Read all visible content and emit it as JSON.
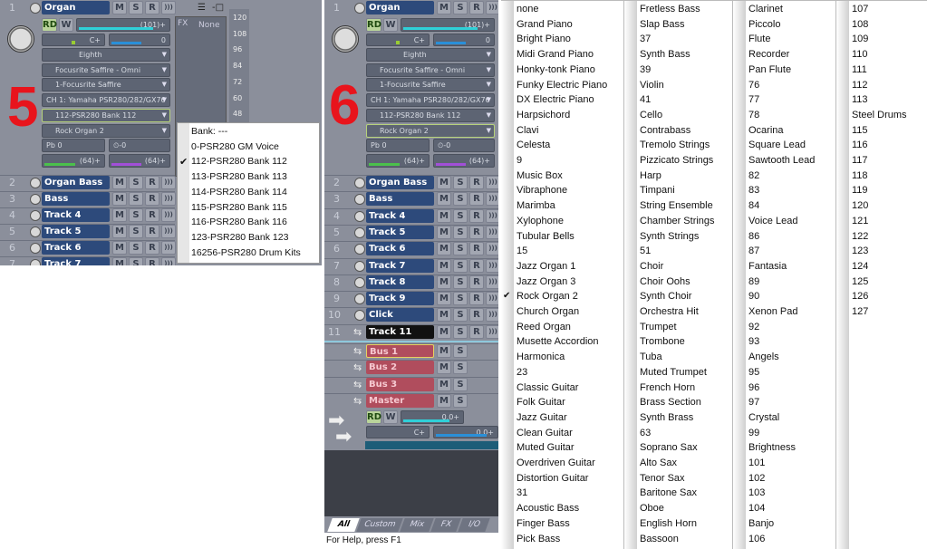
{
  "annotations": {
    "left": "5",
    "middle": "6"
  },
  "colors": {
    "track_name": "#2d4a7b",
    "bus_name": "#b04d5d",
    "panel": "#8b8f9b",
    "annotation_red": "#e8141c",
    "volume_fill": "#2fd0d8",
    "pan_fill": "#2a8fd8",
    "chorus_fill": "#4bc04b",
    "reverb_fill": "#a24fd8"
  },
  "track1": {
    "number": "1",
    "name": "Organ",
    "buttons": [
      "M",
      "S",
      "R",
      ")))"
    ],
    "read": "RD",
    "write": "W",
    "volume": "(101)+",
    "volume_pct": 80,
    "pan": "C+",
    "meter_value": "0",
    "quantize": "Eighth",
    "input": "Focusrite Saffire - Omni",
    "output": "1-Focusrite Saffire",
    "channel": "CH 1: Yamaha PSR280/282/GX76",
    "bank": "112-PSR280 Bank 112",
    "program": "Rock Organ 2",
    "pitch_bend": "0",
    "key_offset": "0",
    "chorus": "(64)+",
    "reverb": "(64)+",
    "fx_label": "FX",
    "fx_value": "None",
    "scale": [
      "120",
      "108",
      "96",
      "84",
      "72",
      "60",
      "48"
    ]
  },
  "left_tracks": [
    {
      "number": "2",
      "name": "Organ Bass"
    },
    {
      "number": "3",
      "name": "Bass"
    },
    {
      "number": "4",
      "name": "Track 4"
    },
    {
      "number": "5",
      "name": "Track 5"
    },
    {
      "number": "6",
      "name": "Track 6"
    },
    {
      "number": "7",
      "name": "Track 7"
    }
  ],
  "middle_tracks": [
    {
      "number": "2",
      "name": "Organ Bass"
    },
    {
      "number": "3",
      "name": "Bass"
    },
    {
      "number": "4",
      "name": "Track 4"
    },
    {
      "number": "5",
      "name": "Track 5"
    },
    {
      "number": "6",
      "name": "Track 6"
    },
    {
      "number": "7",
      "name": "Track 7"
    },
    {
      "number": "8",
      "name": "Track 8"
    },
    {
      "number": "9",
      "name": "Track 9"
    },
    {
      "number": "10",
      "name": "Click"
    },
    {
      "number": "11",
      "name": "Track 11",
      "audio": true
    }
  ],
  "buses": [
    {
      "name": "Bus 1"
    },
    {
      "name": "Bus 2"
    },
    {
      "name": "Bus 3"
    },
    {
      "name": "Master"
    }
  ],
  "master": {
    "read": "RD",
    "write": "W",
    "volume": "0.0+",
    "pan": "C+",
    "meter": "0.0+"
  },
  "bank_menu": {
    "header": "Bank: ---",
    "items": [
      "0-PSR280 GM Voice",
      "112-PSR280 Bank 112",
      "113-PSR280 Bank 113",
      "114-PSR280 Bank 114",
      "115-PSR280 Bank 115",
      "116-PSR280 Bank 116",
      "123-PSR280 Bank 123",
      "16256-PSR280 Drum Kits"
    ],
    "checked": "112-PSR280 Bank 112"
  },
  "tabs": [
    "All",
    "Custom",
    "Mix",
    "FX",
    "I/O"
  ],
  "active_tab": "All",
  "status_bar": "For Help, press F1",
  "program_list": {
    "checked": "Rock Organ 2",
    "columns": [
      [
        "none",
        "Grand Piano",
        "Bright Piano",
        "Midi Grand Piano",
        "Honky-tonk Piano",
        "Funky Electric Piano",
        "DX Electric Piano",
        "Harpsichord",
        "Clavi",
        "Celesta",
        "9",
        "Music Box",
        "Vibraphone",
        "Marimba",
        "Xylophone",
        "Tubular Bells",
        "15",
        "Jazz Organ 1",
        "Jazz Organ 3",
        "Rock Organ 2",
        "Church Organ",
        "Reed Organ",
        "Musette Accordion",
        "Harmonica",
        "23",
        "Classic Guitar",
        "Folk Guitar",
        "Jazz Guitar",
        "Clean Guitar",
        "Muted Guitar",
        "Overdriven Guitar",
        "Distortion Guitar",
        "31",
        "Acoustic Bass",
        "Finger Bass",
        "Pick Bass"
      ],
      [
        "Fretless Bass",
        "Slap Bass",
        "37",
        "Synth Bass",
        "39",
        "Violin",
        "41",
        "Cello",
        "Contrabass",
        "Tremolo Strings",
        "Pizzicato Strings",
        "Harp",
        "Timpani",
        "String Ensemble",
        "Chamber Strings",
        "Synth Strings",
        "51",
        "Choir",
        "Choir Oohs",
        "Synth Choir",
        "Orchestra Hit",
        "Trumpet",
        "Trombone",
        "Tuba",
        "Muted Trumpet",
        "French Horn",
        "Brass Section",
        "Synth Brass",
        "63",
        "Soprano Sax",
        "Alto Sax",
        "Tenor Sax",
        "Baritone Sax",
        "Oboe",
        "English Horn",
        "Bassoon"
      ],
      [
        "Clarinet",
        "Piccolo",
        "Flute",
        "Recorder",
        "Pan Flute",
        "76",
        "77",
        "78",
        "Ocarina",
        "Square Lead",
        "Sawtooth Lead",
        "82",
        "83",
        "84",
        "Voice Lead",
        "86",
        "87",
        "Fantasia",
        "89",
        "90",
        "Xenon Pad",
        "92",
        "93",
        "Angels",
        "95",
        "96",
        "97",
        "Crystal",
        "99",
        "Brightness",
        "101",
        "102",
        "103",
        "104",
        "Banjo",
        "106"
      ],
      [
        "107",
        "108",
        "109",
        "110",
        "111",
        "112",
        "113",
        "Steel Drums",
        "115",
        "116",
        "117",
        "118",
        "119",
        "120",
        "121",
        "122",
        "123",
        "124",
        "125",
        "126",
        "127"
      ]
    ]
  }
}
